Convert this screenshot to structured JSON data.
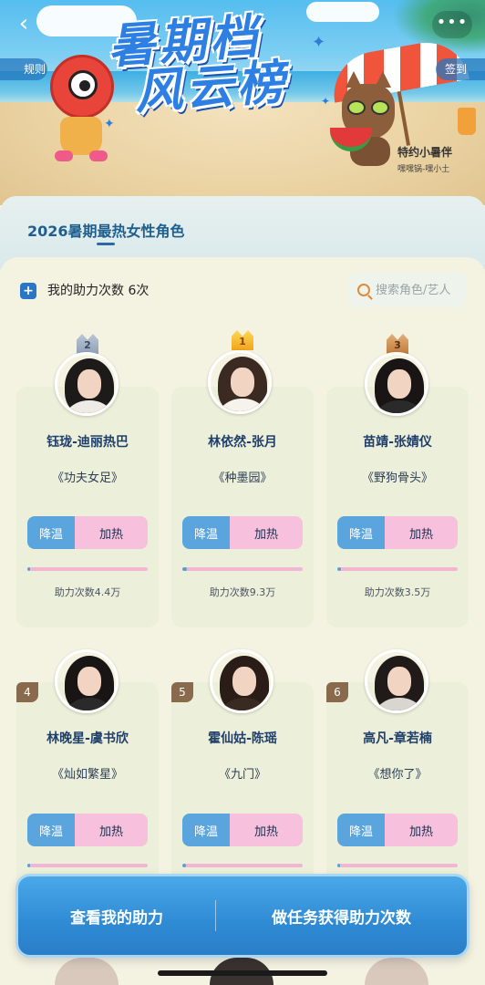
{
  "nav": {
    "back_icon": "chevron-left-icon",
    "more_label": "•••"
  },
  "banner": {
    "title_line1": "暑期档",
    "title_line2": "风云榜",
    "rules_label": "规则",
    "signin_label": "签到",
    "sponsor_title": "特约小暑伴",
    "sponsor_sub": "嘿嘿锅-嘿小土"
  },
  "category": {
    "active_tab": "2026暑期最热女性角色"
  },
  "boost": {
    "label": "我的助力次数 6次"
  },
  "search": {
    "placeholder": "搜索角色/艺人"
  },
  "buttons": {
    "cool": "降温",
    "heat": "加热"
  },
  "colors": {
    "accent_blue": "#2f8ad4",
    "heat_pink": "#f7c0dc",
    "cool_blue": "#5aa5dd",
    "gold": "#f0a51c"
  },
  "cards": [
    {
      "rank": "2",
      "character": "钰珑-迪丽热巴",
      "show": "《功夫女足》",
      "boost_total": "助力次数4.4万",
      "progress": 0.02
    },
    {
      "rank": "1",
      "character": "林依然-张月",
      "show": "《种墨园》",
      "boost_total": "助力次数9.3万",
      "progress": 0.04
    },
    {
      "rank": "3",
      "character": "苗靖-张婧仪",
      "show": "《野狗骨头》",
      "boost_total": "助力次数3.5万",
      "progress": 0.03
    },
    {
      "rank": "4",
      "character": "林晚星-虞书欣",
      "show": "《灿如繁星》",
      "boost_total": "",
      "progress": 0.02
    },
    {
      "rank": "5",
      "character": "霍仙姑-陈瑶",
      "show": "《九门》",
      "boost_total": "",
      "progress": 0.03
    },
    {
      "rank": "6",
      "character": "高凡-章若楠",
      "show": "《想你了》",
      "boost_total": "",
      "progress": 0.02
    }
  ],
  "actions": {
    "view_mine": "查看我的助力",
    "do_tasks": "做任务获得助力次数"
  }
}
